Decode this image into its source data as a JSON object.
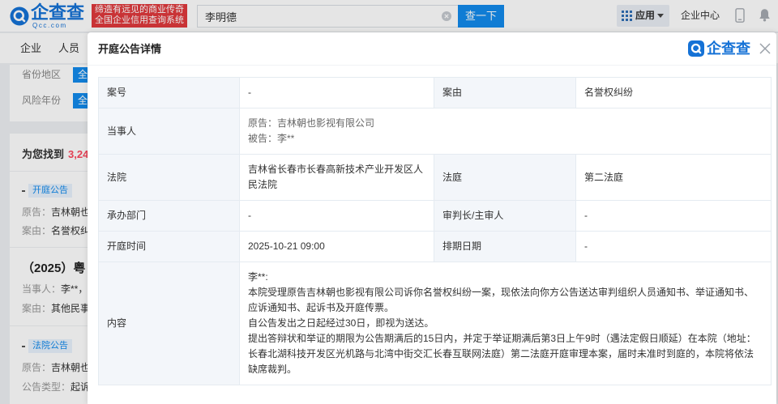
{
  "header": {
    "logo": {
      "name": "企查查",
      "domain": "Qcc.com"
    },
    "slogan": [
      "缔造有远见的商业传奇",
      "全国企业信用查询系统"
    ],
    "search": {
      "value": "李明德",
      "button": "查一下"
    },
    "apps_menu": "应用",
    "enterprise_center": "企业中心"
  },
  "nav": {
    "tabs": [
      "企业",
      "人员"
    ]
  },
  "filters": [
    {
      "label": "省份地区",
      "option": "全"
    },
    {
      "label": "风险年份",
      "option": "全"
    }
  ],
  "results": {
    "found_prefix": "为您找到",
    "count": "3,24",
    "items": [
      {
        "tag": "开庭公告",
        "lines": [
          {
            "k": "原告：",
            "v": "吉林朝也"
          },
          {
            "k": "案由：",
            "v": "名誉权纠"
          }
        ]
      },
      {
        "title": "（2025）粤",
        "lines": [
          {
            "k": "当事人：",
            "v": "李**，"
          },
          {
            "k": "案由：",
            "v": "其他民事"
          }
        ]
      },
      {
        "tag": "法院公告",
        "lines": [
          {
            "k": "原告：",
            "v": "吉林朝也"
          },
          {
            "k": "公告类型：",
            "v": "起诉"
          }
        ]
      }
    ]
  },
  "modal": {
    "title": "开庭公告详情",
    "brand": "企查查",
    "detail": {
      "case_no": {
        "label": "案号",
        "value": "-"
      },
      "cause": {
        "label": "案由",
        "value": "名誉权纠纷"
      },
      "parties": {
        "label": "当事人",
        "plaintiff": "原告：吉林朝也影视有限公司",
        "defendant": "被告：李**"
      },
      "court": {
        "label": "法院",
        "value": "吉林省长春市长春高新技术产业开发区人民法院"
      },
      "tribunal": {
        "label": "法庭",
        "value": "第二法庭"
      },
      "department": {
        "label": "承办部门",
        "value": "-"
      },
      "judge": {
        "label": "审判长/主审人",
        "value": "-"
      },
      "hearing_time": {
        "label": "开庭时间",
        "value": "2025-10-21 09:00"
      },
      "schedule_date": {
        "label": "排期日期",
        "value": "-"
      },
      "content": {
        "label": "内容",
        "paragraphs": [
          "李**:",
          "本院受理原告吉林朝也影视有限公司诉你名誉权纠纷一案，现依法向你方公告送达审判组织人员通知书、举证通知书、应诉通知书、起诉书及开庭传票。",
          "自公告发出之日起经过30日，即视为送达。",
          "提出答辩状和举证的期限为公告期满后的15日内，并定于举证期满后第3日上午9时（遇法定假日顺延）在本院（地址：长春北湖科技开发区光机路与北湾中街交汇长春互联网法庭）第二法庭开庭审理本案，届时未准时到庭的，本院将依法缺席裁判。"
        ]
      }
    }
  },
  "icons": {
    "logo": "qcc-logo-icon",
    "search_clear": "clear-icon",
    "apps": "grid-icon",
    "apps_dropdown": "chevron-down-icon",
    "mobile": "phone-icon",
    "notifications": "bell-icon",
    "modal_brand": "qcc-logo-icon",
    "modal_close": "close-icon"
  },
  "colors": {
    "brand_blue": "#128bed",
    "logo_blue": "#1572d6",
    "slogan_red": "#e0393d",
    "count_red": "#fd485e"
  }
}
